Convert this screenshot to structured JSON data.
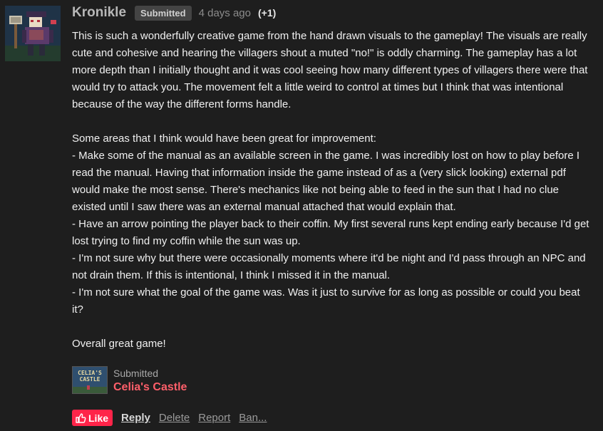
{
  "comment": {
    "author": "Kronikle",
    "badge": "Submitted",
    "time": "4 days ago",
    "votes": "(+1)",
    "avatar_icon": "pixel-art-avatar-icon",
    "paragraphs": [
      [
        "This is such a wonderfully creative game from the hand drawn visuals to the gameplay!  The visuals are really cute and cohesive and hearing the villagers shout a muted \"no!\" is oddly charming.  The gameplay has a lot more depth than I initially thought and it was cool seeing how many different types of villagers there were that would try to attack you.  The movement felt a little weird to control at times but I think that was intentional because of the way the different forms handle."
      ],
      [
        "Some areas that I think would have been great for improvement:",
        "- Make some of the manual as an available screen in the game.  I was incredibly lost on how to play before I read the manual.  Having that information inside the game instead of as a (very slick looking) external pdf would make the most sense.  There's mechanics like not being able to feed in the sun that I had no clue existed until I saw there was an external manual attached that would explain that.",
        "- Have an arrow pointing the player back to their coffin.  My first several runs kept ending early because I'd get lost trying to find my coffin while the sun was up.",
        "- I'm not sure why but there were occasionally moments where it'd be night and I'd pass through an NPC and not drain them.  If this is intentional, I think I missed it in the manual.",
        "- I'm not sure what the goal of the game was.  Was it just to survive for as long as possible or could you beat it?"
      ],
      [
        "Overall great game!"
      ]
    ]
  },
  "submission": {
    "label": "Submitted",
    "game_title": "Celia's Castle",
    "thumb_text_1": "CELIA'S",
    "thumb_text_2": "CASTLE"
  },
  "actions": {
    "like": "Like",
    "reply": "Reply",
    "delete": "Delete",
    "report": "Report",
    "ban": "Ban..."
  },
  "colors": {
    "accent": "#ff2449",
    "game_title": "#ff5f6a",
    "background": "#1e1e1e"
  }
}
